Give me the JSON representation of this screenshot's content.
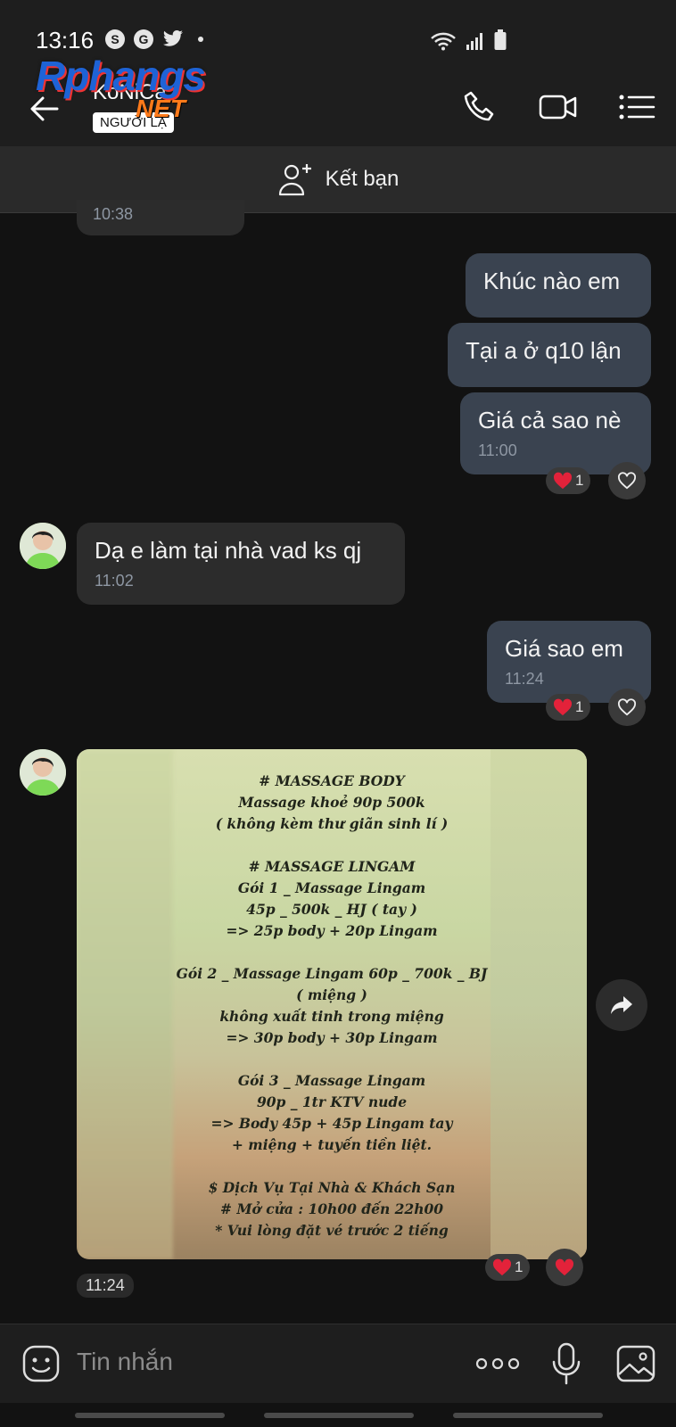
{
  "status": {
    "time": "13:16"
  },
  "watermark": {
    "main": "Rphangs",
    "sub": "NET"
  },
  "header": {
    "name": "KoNiCa",
    "badge": "NGƯỜI LẠ"
  },
  "add_friend": {
    "label": "Kết bạn"
  },
  "messages": [
    {
      "side": "received",
      "time": "10:38"
    },
    {
      "side": "sent",
      "text": "Khúc nào em"
    },
    {
      "side": "sent",
      "text": "Tại a ở q10 lận"
    },
    {
      "side": "sent",
      "text": "Giá cả sao nè",
      "time": "11:00",
      "reaction_count": "1"
    },
    {
      "side": "received",
      "text": "Dạ e làm tại nhà vad ks qj",
      "time": "11:02"
    },
    {
      "side": "sent",
      "text": "Giá sao em",
      "time": "11:24",
      "reaction_count": "1"
    },
    {
      "side": "received",
      "type": "image",
      "time": "11:24",
      "reaction_count": "1"
    }
  ],
  "poster_lines": [
    "# MASSAGE BODY",
    "Massage khoẻ 90p 500k",
    "( không kèm thư giãn sinh lí )",
    "",
    "# MASSAGE LINGAM",
    "Gói 1 _ Massage Lingam",
    "45p _ 500k _ HJ  ( tay )",
    "=> 25p body + 20p Lingam",
    "",
    "Gói 2 _ Massage Lingam 60p _ 700k _ BJ",
    "( miệng )",
    "không xuất tinh trong miệng",
    "=> 30p body + 30p Lingam",
    "",
    "Gói 3  _  Massage Lingam",
    "90p _ 1tr KTV nude",
    "=> Body 45p + 45p Lingam tay",
    "+ miệng + tuyến tiền liệt.",
    "",
    "$ Dịch Vụ Tại Nhà & Khách Sạn",
    "# Mở cửa : 10h00 đến 22h00",
    "* Vui lòng đặt vé trước 2 tiếng"
  ],
  "input": {
    "placeholder": "Tin nhắn"
  },
  "colors": {
    "sent_bubble": "#3a4350",
    "received_bubble": "#2c2c2c",
    "heart": "#e3223a"
  }
}
